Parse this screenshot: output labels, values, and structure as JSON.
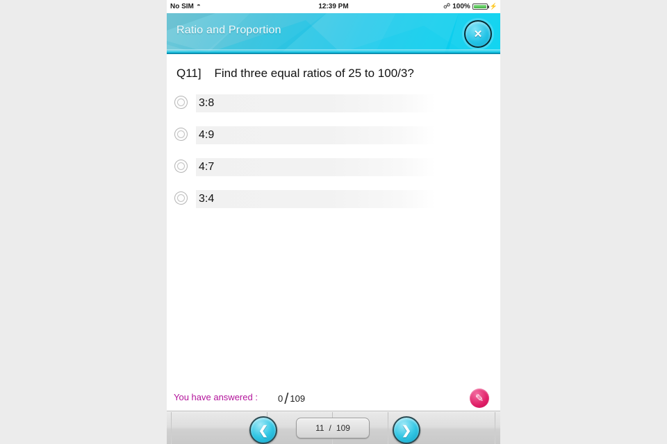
{
  "statusbar": {
    "carrier": "No SIM",
    "wifi_icon": "wifi-icon",
    "time": "12:39 PM",
    "bluetooth_icon": "bluetooth-icon",
    "battery_percent": "100%",
    "battery_icon": "battery-icon",
    "charging_icon": "charging-bolt-icon"
  },
  "header": {
    "title": "Ratio and Proportion",
    "close_icon": "close-icon",
    "close_label": "✕",
    "accent_color": "#00d2f0"
  },
  "question": {
    "number": "Q11]",
    "text": "Q11]    Find three equal ratios of 25 to 100/3?"
  },
  "options": [
    {
      "label": "3:8",
      "selected": false
    },
    {
      "label": "4:9",
      "selected": false
    },
    {
      "label": "4:7",
      "selected": false
    },
    {
      "label": "3:4",
      "selected": false
    }
  ],
  "answered": {
    "label": "You have answered :",
    "count": "0",
    "separator": "/",
    "total": "109",
    "label_color": "#b3149b",
    "notes_icon": "pen-icon",
    "notes_glyph": "✎",
    "notes_color": "#e01f67"
  },
  "toolbar": {
    "prev_icon": "chevron-left-icon",
    "prev_glyph": "❮",
    "next_icon": "chevron-right-icon",
    "next_glyph": "❯",
    "page_current": "11",
    "page_separator": "/",
    "page_total": "109"
  }
}
